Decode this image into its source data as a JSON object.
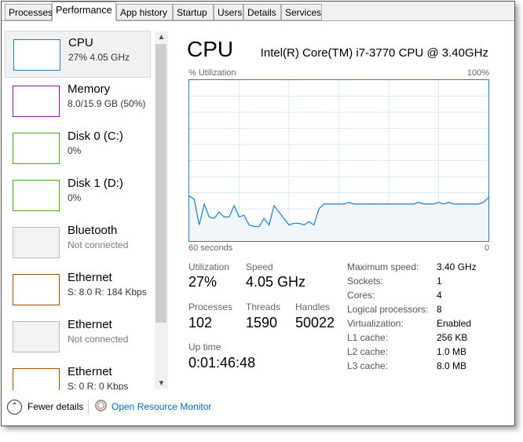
{
  "tabs": [
    "Processes",
    "Performance",
    "App history",
    "Startup",
    "Users",
    "Details",
    "Services"
  ],
  "active_tab": "Performance",
  "sidebar": [
    {
      "name": "CPU",
      "sub": "27% 4.05 GHz",
      "color": "#1c7ed0"
    },
    {
      "name": "Memory",
      "sub": "8.0/15.9 GB (50%)",
      "color": "#8b12ae"
    },
    {
      "name": "Disk 0 (C:)",
      "sub": "0%",
      "color": "#4da60c"
    },
    {
      "name": "Disk 1 (D:)",
      "sub": "0%",
      "color": "#4da60c"
    },
    {
      "name": "Bluetooth",
      "sub": "Not connected",
      "color": "#bbbbbb"
    },
    {
      "name": "Ethernet",
      "sub": "S: 8.0  R: 184 Kbps",
      "color": "#a74f01"
    },
    {
      "name": "Ethernet",
      "sub": "Not connected",
      "color": "#bbbbbb"
    },
    {
      "name": "Ethernet",
      "sub": "S: 0  R: 0 Kbps",
      "color": "#a74f01"
    }
  ],
  "main": {
    "title": "CPU",
    "model": "Intel(R) Core(TM) i7-3770 CPU @ 3.40GHz",
    "y_label": "% Utilization",
    "y_max": "100%",
    "x_left": "60 seconds",
    "x_right": "0",
    "utilization_label": "Utilization",
    "utilization": "27%",
    "speed_label": "Speed",
    "speed": "4.05 GHz",
    "processes_label": "Processes",
    "processes": "102",
    "threads_label": "Threads",
    "threads": "1590",
    "handles_label": "Handles",
    "handles": "50022",
    "uptime_label": "Up time",
    "uptime": "0:01:46:48",
    "specs": [
      [
        "Maximum speed:",
        "3.40 GHz"
      ],
      [
        "Sockets:",
        "1"
      ],
      [
        "Cores:",
        "4"
      ],
      [
        "Logical processors:",
        "8"
      ],
      [
        "Virtualization:",
        "Enabled"
      ],
      [
        "L1 cache:",
        "256 KB"
      ],
      [
        "L2 cache:",
        "1.0 MB"
      ],
      [
        "L3 cache:",
        "8.0 MB"
      ]
    ]
  },
  "chart_data": {
    "type": "area",
    "xlabel": "60 seconds",
    "ylabel": "% Utilization",
    "ylim": [
      0,
      100
    ],
    "xlim": [
      60,
      0
    ],
    "grid": true,
    "color": "#1c7ed0",
    "values": [
      28,
      26,
      10,
      23,
      15,
      14,
      18,
      15,
      15,
      22,
      15,
      16,
      10,
      9,
      9,
      14,
      10,
      22,
      18,
      14,
      10,
      11,
      11,
      10,
      12,
      10,
      20,
      23,
      23,
      23,
      23,
      23,
      24,
      23,
      23,
      23,
      23,
      23,
      23,
      23,
      23,
      23,
      23,
      23,
      23,
      23,
      24,
      23,
      23,
      23,
      24,
      23,
      24,
      23,
      23,
      23,
      23,
      23,
      23,
      24,
      27
    ]
  },
  "footer": {
    "fewer": "Fewer details",
    "monitor": "Open Resource Monitor"
  }
}
